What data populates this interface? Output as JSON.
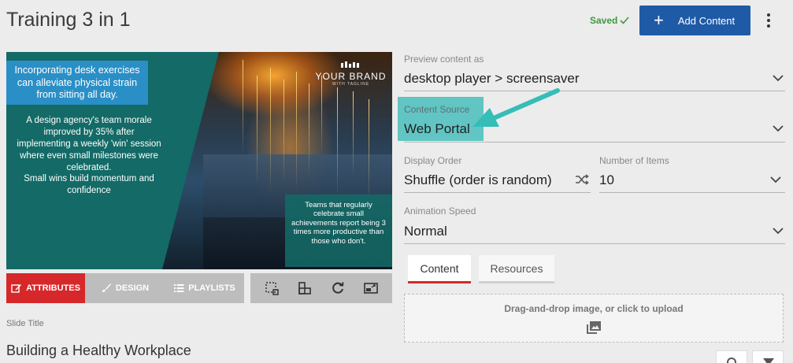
{
  "header": {
    "title": "Training 3 in 1",
    "saved_label": "Saved",
    "add_content_label": "Add Content"
  },
  "preview": {
    "callout": "Incorporating desk exercises can alleviate physical strain from sitting all day.",
    "stat_text": "A design agency's team morale improved by 35% after implementing a weekly 'win' session where even small milestones were celebrated.",
    "tagline": "Small wins build momentum and confidence",
    "box_text": "Teams that regularly celebrate small achievements report being 3 times more productive than those who don't.",
    "brand_name": "YOUR BRAND",
    "brand_tag": "WITH TAGLINE"
  },
  "left_tabs": {
    "attributes": "ATTRIBUTES",
    "design": "DESIGN",
    "playlists": "PLAYLISTS"
  },
  "slide": {
    "title_label": "Slide Title",
    "title_value": "Building a Healthy Workplace"
  },
  "settings": {
    "preview_as_label": "Preview content as",
    "preview_as_value": "desktop player > screensaver",
    "content_source_label": "Content Source",
    "content_source_value": "Web Portal",
    "display_order_label": "Display Order",
    "display_order_value": "Shuffle (order is random)",
    "num_items_label": "Number of Items",
    "num_items_value": "10",
    "animation_speed_label": "Animation Speed",
    "animation_speed_value": "Normal"
  },
  "right_tabs": {
    "content": "Content",
    "resources": "Resources"
  },
  "upload": {
    "label": "Drag-and-drop image, or click to upload"
  },
  "colors": {
    "primary_blue": "#1f5aa6",
    "active_red": "#d6282b",
    "highlight_teal": "#61c5c4",
    "saved_green": "#3d9a3d"
  }
}
